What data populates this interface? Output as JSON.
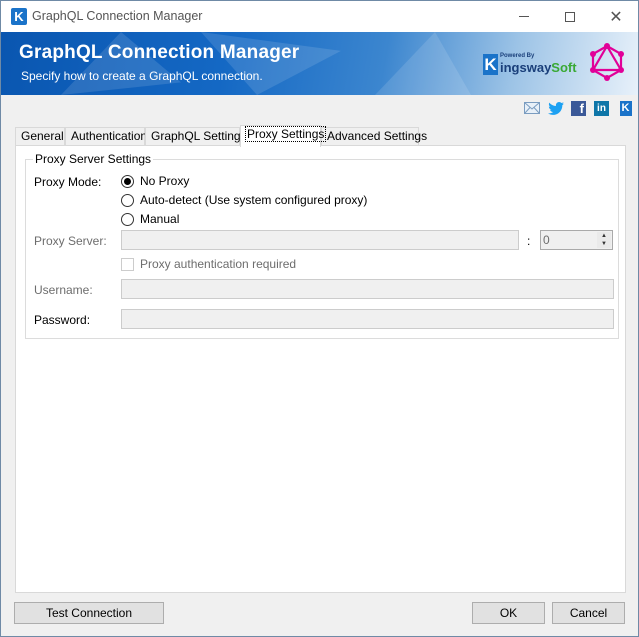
{
  "window": {
    "title": "GraphQL Connection Manager",
    "controls": {
      "minimize": "minimize",
      "maximize": "maximize",
      "close": "close"
    }
  },
  "banner": {
    "title": "GraphQL Connection Manager",
    "subtitle": "Specify how to create a GraphQL connection.",
    "powered_by": "Powered By",
    "brand_k": "K",
    "brand_name": "ingsway",
    "brand_suffix": "Soft"
  },
  "social_icons": [
    "mail-icon",
    "twitter-icon",
    "facebook-icon",
    "linkedin-icon",
    "kingswaysoft-icon"
  ],
  "tabs": [
    {
      "label": "General",
      "active": false
    },
    {
      "label": "Authentication",
      "active": false
    },
    {
      "label": "GraphQL Settings",
      "active": false
    },
    {
      "label": "Proxy Settings",
      "active": true
    },
    {
      "label": "Advanced Settings",
      "active": false
    }
  ],
  "proxy": {
    "group_title": "Proxy Server Settings",
    "mode_label": "Proxy Mode:",
    "modes": [
      {
        "label": "No Proxy",
        "selected": true
      },
      {
        "label": "Auto-detect (Use system configured proxy)",
        "selected": false
      },
      {
        "label": "Manual",
        "selected": false
      }
    ],
    "server_label": "Proxy Server:",
    "server_value": "",
    "port_separator": ":",
    "port_value": "0",
    "auth_required_label": "Proxy authentication required",
    "auth_required_checked": false,
    "username_label": "Username:",
    "username_value": "",
    "password_label": "Password:",
    "password_value": ""
  },
  "footer": {
    "test_connection": "Test Connection",
    "ok": "OK",
    "cancel": "Cancel"
  },
  "colors": {
    "banner_blue": "#1468c4",
    "graphql_pink": "#e10098",
    "kingsway_green": "#3aa935"
  }
}
